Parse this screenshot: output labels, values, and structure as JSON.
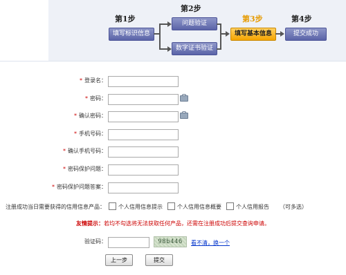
{
  "steps": [
    {
      "number_label": "第1步",
      "title": "填写标识信息"
    },
    {
      "number_label": "第2步",
      "title": "问题验证"
    },
    {
      "alt_title": "数字证书验证"
    },
    {
      "number_label": "第3步",
      "title": "填写基本信息",
      "current": true
    },
    {
      "number_label": "第4步",
      "title": "提交成功"
    }
  ],
  "form": {
    "fields": [
      {
        "label": "登录名：",
        "required": true,
        "value": "",
        "type": "text"
      },
      {
        "label": "密码：",
        "required": true,
        "value": "",
        "type": "password"
      },
      {
        "label": "确认密码：",
        "required": true,
        "value": "",
        "type": "password"
      },
      {
        "label": "手机号码：",
        "required": true,
        "value": "",
        "type": "text"
      },
      {
        "label": "确认手机号码：",
        "required": true,
        "value": "",
        "type": "text"
      },
      {
        "label": "密码保护问题：",
        "required": true,
        "value": "",
        "type": "text"
      },
      {
        "label": "密码保护问题答案：",
        "required": true,
        "value": "",
        "type": "text"
      }
    ],
    "credit_products": {
      "label": "注册成功当日需要获得的信用信息产品：",
      "options": [
        {
          "label": "个人信用信息提示",
          "checked": false
        },
        {
          "label": "个人信用信息概要",
          "checked": false
        },
        {
          "label": "个人信用报告",
          "checked": false
        }
      ],
      "note": "（可多选）"
    },
    "tip": {
      "prefix": "友情提示：",
      "text": "若均不勾选将无法获取任何产品，还需在注册成功后提交查询申请。"
    },
    "captcha": {
      "label": "验证码：",
      "value": "",
      "image_text": "98b446",
      "refresh_link": "看不清，换一个"
    },
    "buttons": {
      "prev": "上一步",
      "submit": "提交"
    }
  },
  "colors": {
    "step_box": "#5a63a8",
    "step_current": "#f4a400",
    "required": "#cc0000",
    "link": "#0033cc"
  }
}
